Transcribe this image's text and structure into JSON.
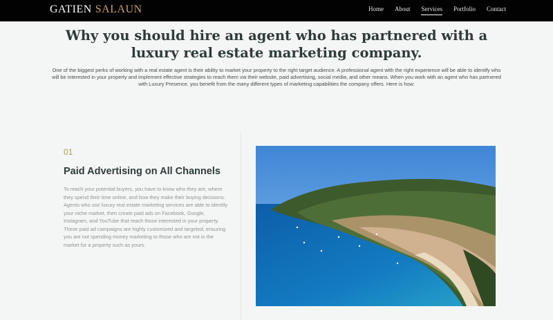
{
  "header": {
    "logo_first": "GATIEN",
    "logo_last": "SALAUN",
    "nav": [
      "Home",
      "About",
      "Services",
      "Portfolio",
      "Contact"
    ],
    "active_nav": "Services"
  },
  "main": {
    "headline": "Why you should hire an agent who has partnered with a luxury real estate marketing company.",
    "intro": "One of the biggest perks of working with a real estate agent is their ability to market your property to the right target audience. A professional agent with the right experience will be able to identify who will be interested in your property and implement effective strategies to reach them via their website, paid advertising, social media, and other means. When you work with an agent who has partnered with Luxury Presence, you benefit from the many different types of marketing capabilities the company offers. Here is how:"
  },
  "section": {
    "number": "01",
    "title": "Paid Advertising on All Channels",
    "body": "To reach your potential buyers, you have to know who they are, where they spend their time online, and how they make their buying decisions. Agents who use luxury real estate marketing services are able to identify your niche market, then create paid ads on Facebook, Google, Instagram, and YouTube that reach those interested in your property. These paid ad campaigns are highly customized and targeted, ensuring you are not spending money marketing to those who are not in the market for a property such as yours."
  },
  "colors": {
    "accent_gold": "#b79a52",
    "logo_gold": "#c9a36b",
    "header_bg": "#020202",
    "page_bg": "#f3f6f5"
  }
}
